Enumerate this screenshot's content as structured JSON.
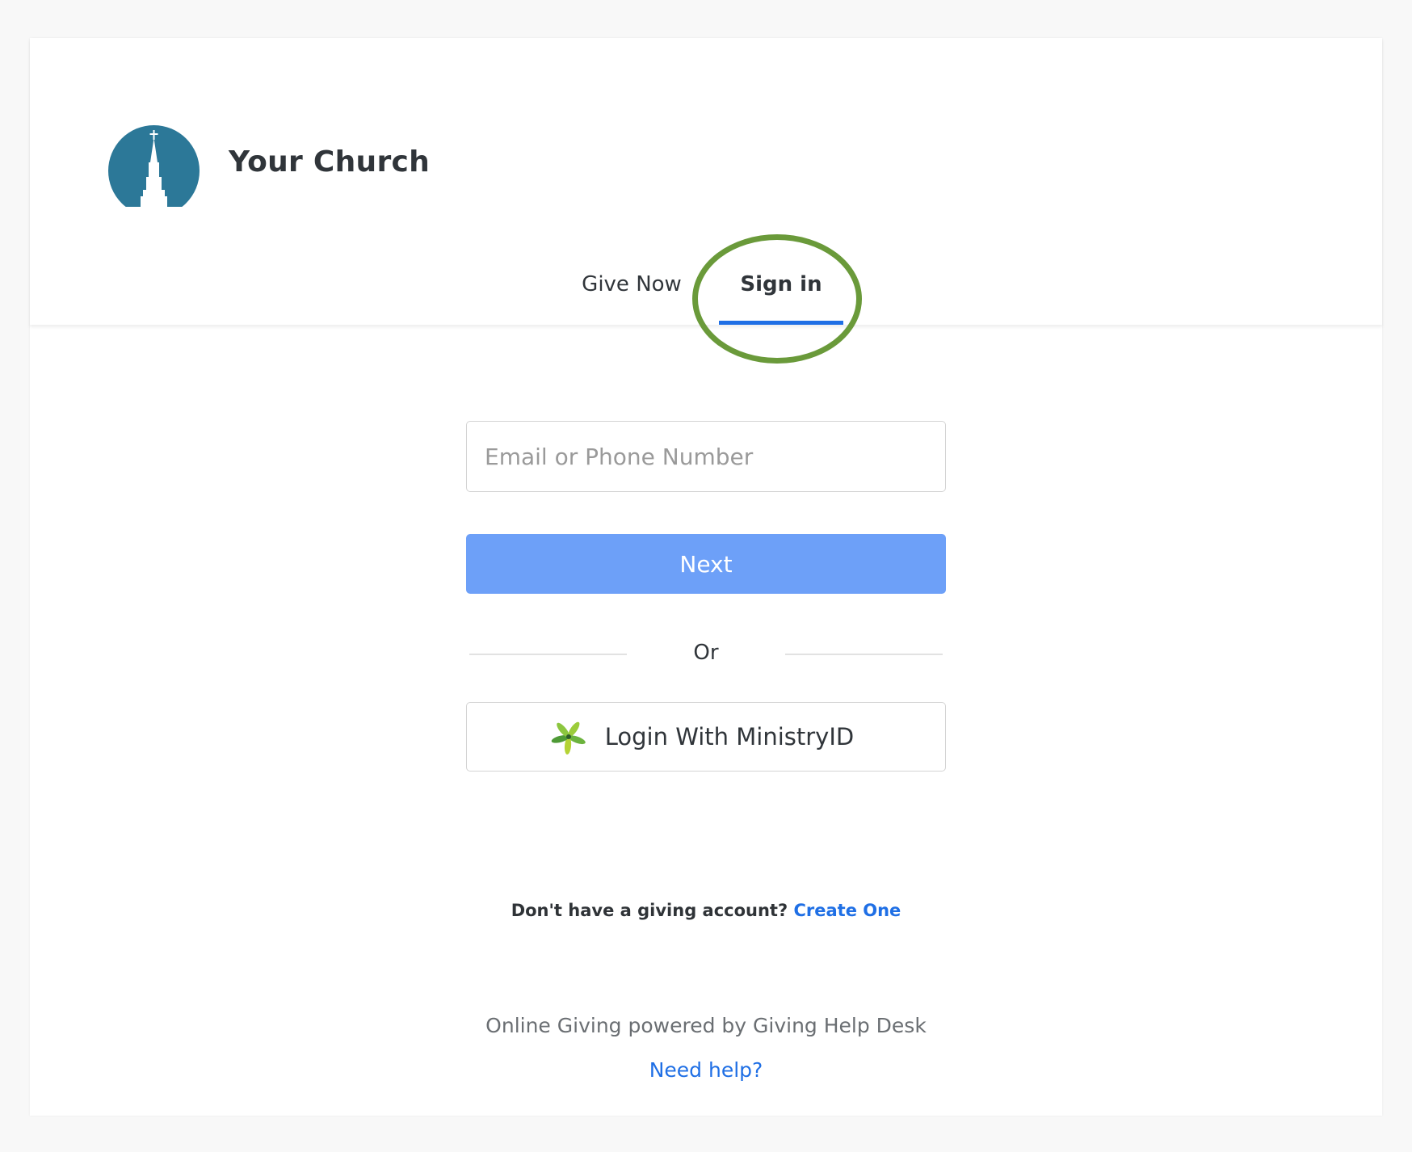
{
  "church": {
    "name": "Your Church",
    "logo_icon": "church-steeple-icon",
    "logo_color": "#2c7898"
  },
  "tabs": [
    {
      "label": "Give Now",
      "active": false
    },
    {
      "label": "Sign in",
      "active": true
    }
  ],
  "annotation": {
    "color": "#6a9a3a",
    "target": "Sign in"
  },
  "login": {
    "email_placeholder": "Email or Phone Number",
    "email_value": "",
    "next_label": "Next",
    "next_color": "#6da0f8",
    "or_label": "Or",
    "ministry_label": "Login With MinistryID",
    "ministry_icon": "ministryid-leaf-icon"
  },
  "account": {
    "prompt": "Don't have a giving account?",
    "create_label": "Create One"
  },
  "footer": {
    "powered_by": "Online Giving powered by Giving Help Desk",
    "help_label": "Need help?"
  },
  "accent_color": "#1f6fe5"
}
